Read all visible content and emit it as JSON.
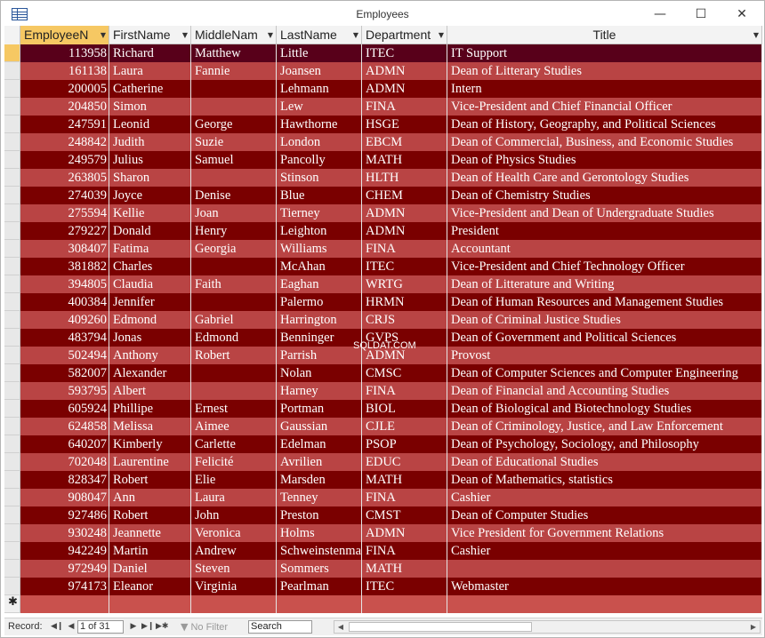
{
  "window": {
    "title": "Employees"
  },
  "columns": [
    {
      "label": "EmployeeN",
      "active": true
    },
    {
      "label": "FirstName"
    },
    {
      "label": "MiddleNam"
    },
    {
      "label": "LastName"
    },
    {
      "label": "Department"
    },
    {
      "label": "Title"
    }
  ],
  "rows": [
    [
      "113958",
      "Richard",
      "Matthew",
      "Little",
      "ITEC",
      "IT Support"
    ],
    [
      "161138",
      "Laura",
      "Fannie",
      "Joansen",
      "ADMN",
      "Dean of Litterary Studies"
    ],
    [
      "200005",
      "Catherine",
      "",
      "Lehmann",
      "ADMN",
      "Intern"
    ],
    [
      "204850",
      "Simon",
      "",
      "Lew",
      "FINA",
      "Vice-President and Chief Financial Officer"
    ],
    [
      "247591",
      "Leonid",
      "George",
      "Hawthorne",
      "HSGE",
      "Dean of History, Geography, and Political Sciences"
    ],
    [
      "248842",
      "Judith",
      "Suzie",
      "London",
      "EBCM",
      "Dean of Commercial, Business, and Economic Studies"
    ],
    [
      "249579",
      "Julius",
      "Samuel",
      "Pancolly",
      "MATH",
      "Dean of Physics Studies"
    ],
    [
      "263805",
      "Sharon",
      "",
      "Stinson",
      "HLTH",
      "Dean of Health Care and Gerontology Studies"
    ],
    [
      "274039",
      "Joyce",
      "Denise",
      "Blue",
      "CHEM",
      "Dean of Chemistry Studies"
    ],
    [
      "275594",
      "Kellie",
      "Joan",
      "Tierney",
      "ADMN",
      "Vice-President and Dean of Undergraduate Studies"
    ],
    [
      "279227",
      "Donald",
      "Henry",
      "Leighton",
      "ADMN",
      "President"
    ],
    [
      "308407",
      "Fatima",
      "Georgia",
      "Williams",
      "FINA",
      "Accountant"
    ],
    [
      "381882",
      "Charles",
      "",
      "McAhan",
      "ITEC",
      "Vice-President and Chief Technology Officer"
    ],
    [
      "394805",
      "Claudia",
      "Faith",
      "Eaghan",
      "WRTG",
      "Dean of Litterature and Writing"
    ],
    [
      "400384",
      "Jennifer",
      "",
      "Palermo",
      "HRMN",
      "Dean of Human Resources and Management Studies"
    ],
    [
      "409260",
      "Edmond",
      "Gabriel",
      "Harrington",
      "CRJS",
      "Dean of Criminal Justice Studies"
    ],
    [
      "483794",
      "Jonas",
      "Edmond",
      "Benninger",
      "GVPS",
      "Dean of Government and Political Sciences"
    ],
    [
      "502494",
      "Anthony",
      "Robert",
      "Parrish",
      "ADMN",
      "Provost"
    ],
    [
      "582007",
      "Alexander",
      "",
      "Nolan",
      "CMSC",
      "Dean of Computer Sciences and Computer Engineering"
    ],
    [
      "593795",
      "Albert",
      "",
      "Harney",
      "FINA",
      "Dean of Financial and Accounting Studies"
    ],
    [
      "605924",
      "Phillipe",
      "Ernest",
      "Portman",
      "BIOL",
      "Dean of Biological and Biotechnology Studies"
    ],
    [
      "624858",
      "Melissa",
      "Aimee",
      "Gaussian",
      "CJLE",
      "Dean of Criminology, Justice, and Law Enforcement"
    ],
    [
      "640207",
      "Kimberly",
      "Carlette",
      "Edelman",
      "PSOP",
      "Dean of Psychology, Sociology, and Philosophy"
    ],
    [
      "702048",
      "Laurentine",
      "Felicité",
      "Avrilien",
      "EDUC",
      "Dean of Educational Studies"
    ],
    [
      "828347",
      "Robert",
      "Elie",
      "Marsden",
      "MATH",
      "Dean of Mathematics, statistics"
    ],
    [
      "908047",
      "Ann",
      "Laura",
      "Tenney",
      "FINA",
      "Cashier"
    ],
    [
      "927486",
      "Robert",
      "John",
      "Preston",
      "CMST",
      "Dean of Computer Studies"
    ],
    [
      "930248",
      "Jeannette",
      "Veronica",
      "Holms",
      "ADMN",
      "Vice President for Government Relations"
    ],
    [
      "942249",
      "Martin",
      "Andrew",
      "Schweinstenman",
      "FINA",
      "Cashier"
    ],
    [
      "972949",
      "Daniel",
      "Steven",
      "Sommers",
      "MATH",
      ""
    ],
    [
      "974173",
      "Eleanor",
      "Virginia",
      "Pearlman",
      "ITEC",
      "Webmaster"
    ]
  ],
  "watermark": "SQLDAT.COM",
  "statusbar": {
    "record_label": "Record:",
    "record_value": "1 of 31",
    "no_filter": "No Filter",
    "search": "Search"
  },
  "colors": {
    "dark_row": "#7a0000",
    "light_row": "#b94444",
    "current_row": "#58001a",
    "header_active": "#f6c863"
  }
}
